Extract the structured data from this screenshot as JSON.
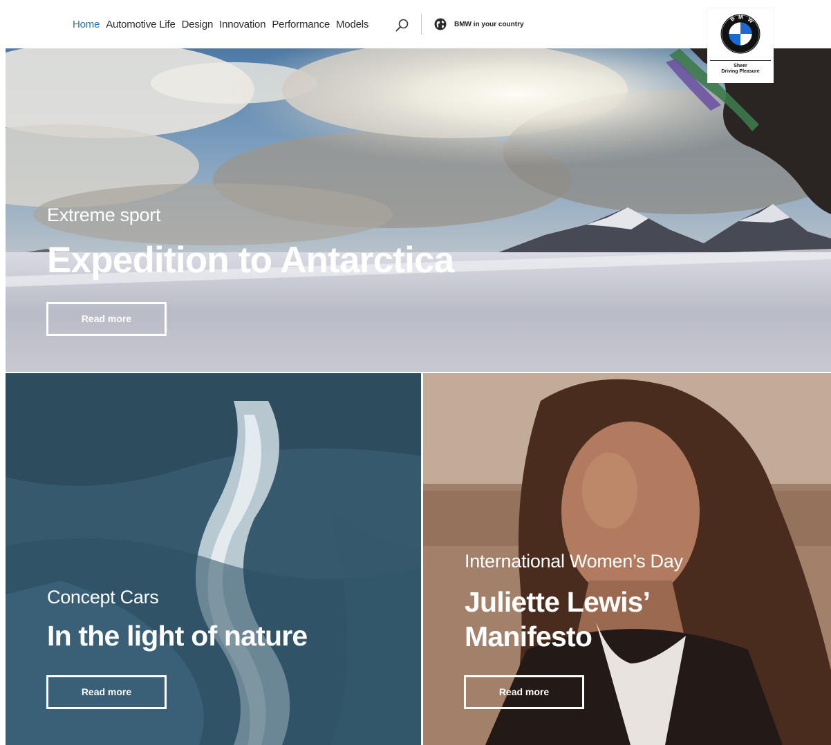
{
  "nav": {
    "links": [
      {
        "label": "Home",
        "active": true
      },
      {
        "label": "Automotive Life",
        "active": false
      },
      {
        "label": "Design",
        "active": false
      },
      {
        "label": "Innovation",
        "active": false
      },
      {
        "label": "Performance",
        "active": false
      },
      {
        "label": "Models",
        "active": false
      }
    ],
    "search_icon": "search-icon",
    "country_icon": "globe-icon",
    "country_label": "BMW in your country"
  },
  "logo": {
    "emblem_letters": "BMW",
    "tagline": "Sheer\nDriving Pleasure"
  },
  "hero": {
    "kicker": "Extreme sport",
    "title": "Expedition to Antarctica",
    "button": "Read more"
  },
  "tiles": [
    {
      "kicker": "Concept Cars",
      "title": "In the light of nature",
      "button": "Read more"
    },
    {
      "kicker": "International Women’s Day",
      "title": "Juliette Lewis’\nManifesto",
      "button": "Read more"
    }
  ],
  "colors": {
    "nav_active": "#2f6fb5",
    "nav_text": "#2b2b2b",
    "bmw_blue": "#1c69d4",
    "overlay_text": "#ffffff"
  }
}
